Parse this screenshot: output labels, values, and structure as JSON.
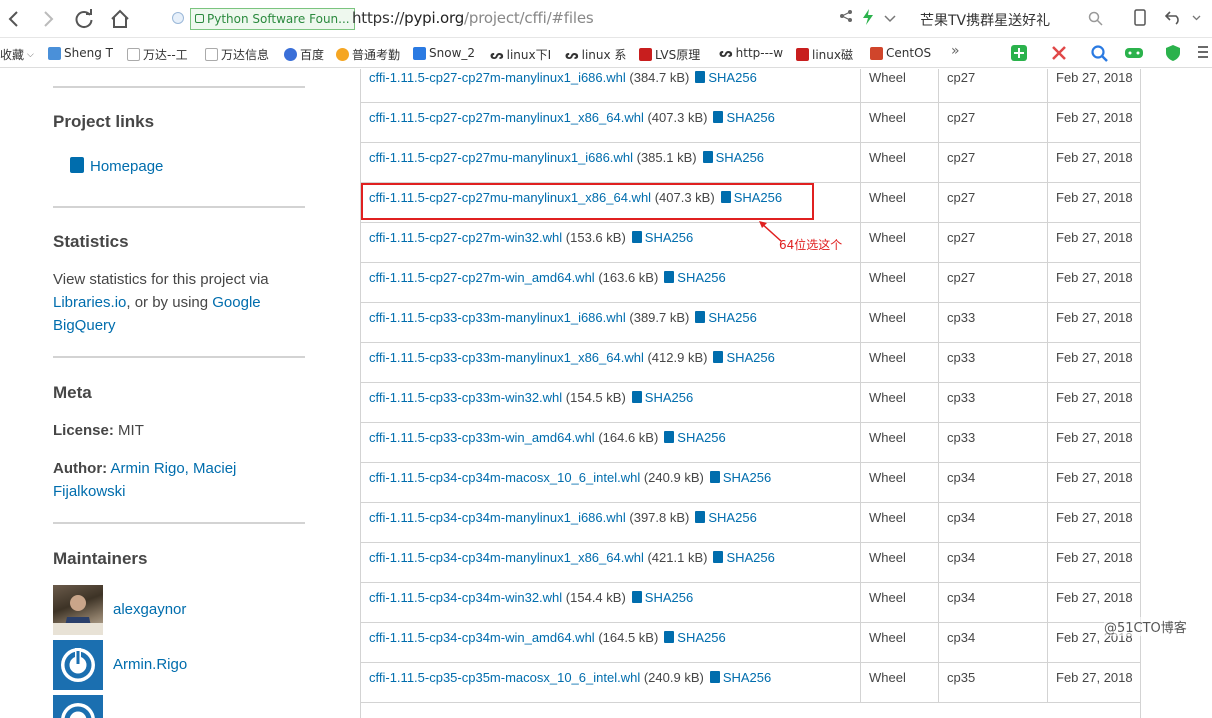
{
  "browser": {
    "site_badge": "Python Software Foun...",
    "url_scheme": "https://",
    "url_host": "pypi.org",
    "url_path": "/project/cffi/#files",
    "search_text": "芒果TV携群星送好礼"
  },
  "bookmarks": [
    {
      "label": "收藏",
      "color": "#ffffff"
    },
    {
      "label": "Sheng T",
      "color": "#4a90d9"
    },
    {
      "label": "万达--工",
      "color": "#cccccc"
    },
    {
      "label": "万达信息",
      "color": "#cccccc"
    },
    {
      "label": "百度",
      "color": "#3a6fd8"
    },
    {
      "label": "普通考勤",
      "color": "#f5a623"
    },
    {
      "label": "Snow_2",
      "color": "#2a7ae2"
    },
    {
      "label": "linux下I",
      "color": "#333333"
    },
    {
      "label": "linux 系",
      "color": "#333333"
    },
    {
      "label": "LVS原理",
      "color": "#c81e1e"
    },
    {
      "label": "http---w",
      "color": "#333333"
    },
    {
      "label": "linux磁",
      "color": "#c81e1e"
    },
    {
      "label": "CentOS",
      "color": "#d0452b"
    },
    {
      "label": "»",
      "color": "#ffffff"
    }
  ],
  "sidebar": {
    "project_links_heading": "Project links",
    "homepage_label": "Homepage",
    "statistics_heading": "Statistics",
    "statistics_text_1": "View statistics for this project via",
    "statistics_link_1": "Libraries.io",
    "statistics_text_2": ", or by using",
    "statistics_link_2": "Google",
    "statistics_link_3": "BigQuery",
    "meta_heading": "Meta",
    "license_label": "License:",
    "license_value": "MIT",
    "author_label": "Author:",
    "author_value_1": "Armin Rigo, Maciej",
    "author_value_2": "Fijalkowski",
    "maintainers_heading": "Maintainers",
    "maintainer_1": "alexgaynor",
    "maintainer_2": "Armin.Rigo"
  },
  "files": {
    "sha_label": "SHA256",
    "rows": [
      {
        "name": "cffi-1.11.5-cp27-cp27m-manylinux1_i686.whl",
        "size": "(384.7 kB)",
        "type": "Wheel",
        "python": "cp27",
        "date": "Feb 27, 2018"
      },
      {
        "name": "cffi-1.11.5-cp27-cp27m-manylinux1_x86_64.whl",
        "size": "(407.3 kB)",
        "type": "Wheel",
        "python": "cp27",
        "date": "Feb 27, 2018"
      },
      {
        "name": "cffi-1.11.5-cp27-cp27mu-manylinux1_i686.whl",
        "size": "(385.1 kB)",
        "type": "Wheel",
        "python": "cp27",
        "date": "Feb 27, 2018"
      },
      {
        "name": "cffi-1.11.5-cp27-cp27mu-manylinux1_x86_64.whl",
        "size": "(407.3 kB)",
        "type": "Wheel",
        "python": "cp27",
        "date": "Feb 27, 2018"
      },
      {
        "name": "cffi-1.11.5-cp27-cp27m-win32.whl",
        "size": "(153.6 kB)",
        "type": "Wheel",
        "python": "cp27",
        "date": "Feb 27, 2018"
      },
      {
        "name": "cffi-1.11.5-cp27-cp27m-win_amd64.whl",
        "size": "(163.6 kB)",
        "type": "Wheel",
        "python": "cp27",
        "date": "Feb 27, 2018"
      },
      {
        "name": "cffi-1.11.5-cp33-cp33m-manylinux1_i686.whl",
        "size": "(389.7 kB)",
        "type": "Wheel",
        "python": "cp33",
        "date": "Feb 27, 2018"
      },
      {
        "name": "cffi-1.11.5-cp33-cp33m-manylinux1_x86_64.whl",
        "size": "(412.9 kB)",
        "type": "Wheel",
        "python": "cp33",
        "date": "Feb 27, 2018"
      },
      {
        "name": "cffi-1.11.5-cp33-cp33m-win32.whl",
        "size": "(154.5 kB)",
        "type": "Wheel",
        "python": "cp33",
        "date": "Feb 27, 2018"
      },
      {
        "name": "cffi-1.11.5-cp33-cp33m-win_amd64.whl",
        "size": "(164.6 kB)",
        "type": "Wheel",
        "python": "cp33",
        "date": "Feb 27, 2018"
      },
      {
        "name": "cffi-1.11.5-cp34-cp34m-macosx_10_6_intel.whl",
        "size": "(240.9 kB)",
        "type": "Wheel",
        "python": "cp34",
        "date": "Feb 27, 2018"
      },
      {
        "name": "cffi-1.11.5-cp34-cp34m-manylinux1_i686.whl",
        "size": "(397.8 kB)",
        "type": "Wheel",
        "python": "cp34",
        "date": "Feb 27, 2018"
      },
      {
        "name": "cffi-1.11.5-cp34-cp34m-manylinux1_x86_64.whl",
        "size": "(421.1 kB)",
        "type": "Wheel",
        "python": "cp34",
        "date": "Feb 27, 2018"
      },
      {
        "name": "cffi-1.11.5-cp34-cp34m-win32.whl",
        "size": "(154.4 kB)",
        "type": "Wheel",
        "python": "cp34",
        "date": "Feb 27, 2018"
      },
      {
        "name": "cffi-1.11.5-cp34-cp34m-win_amd64.whl",
        "size": "(164.5 kB)",
        "type": "Wheel",
        "python": "cp34",
        "date": "Feb 27, 2018"
      },
      {
        "name": "cffi-1.11.5-cp35-cp35m-macosx_10_6_intel.whl",
        "size": "(240.9 kB)",
        "type": "Wheel",
        "python": "cp35",
        "date": "Feb 27, 2018"
      }
    ]
  },
  "annotation": {
    "text": "64位选这个",
    "color": "#e02020"
  },
  "watermark": "@51CTO博客",
  "colors": {
    "link": "#006dad",
    "text": "#464646",
    "badge_green": "#2b8a3e"
  }
}
